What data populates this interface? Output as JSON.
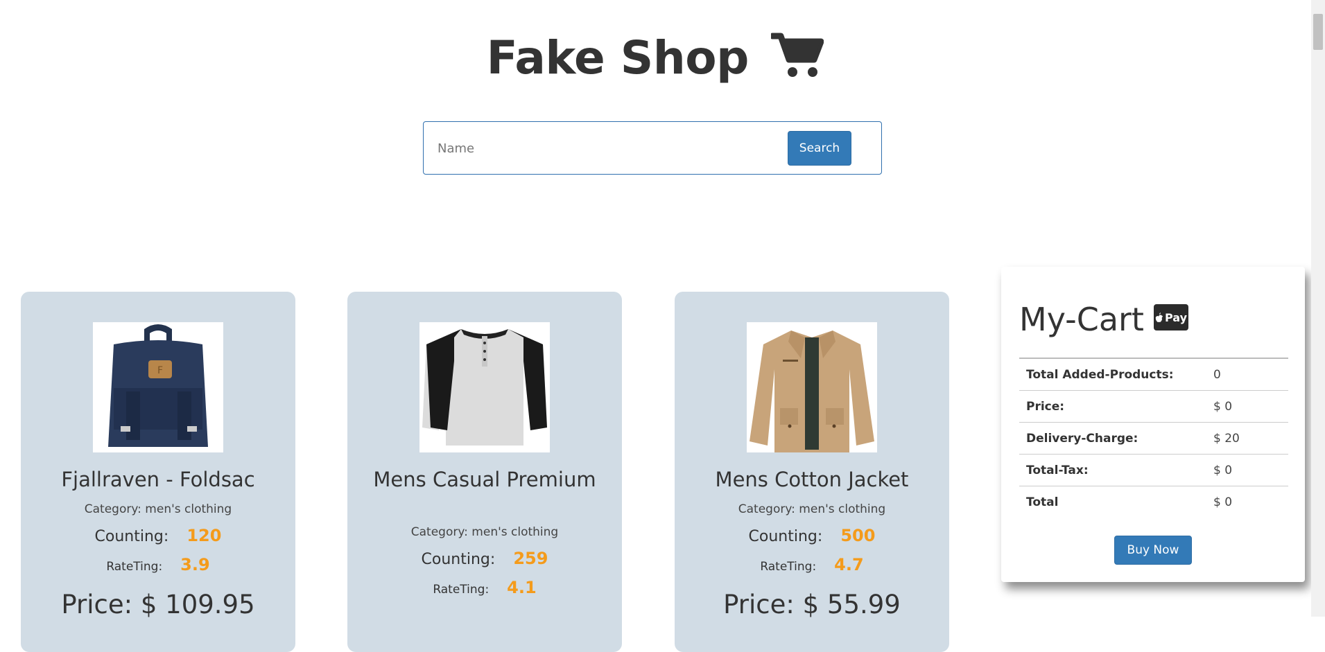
{
  "header": {
    "title": "Fake Shop",
    "icon": "cart-icon"
  },
  "search": {
    "placeholder": "Name",
    "value": "",
    "button_label": "Search"
  },
  "products": [
    {
      "name": "Fjallraven - Foldsac",
      "category": "Category: men's clothing",
      "counting_label": "Counting:",
      "counting_value": "120",
      "rating_label": "RateTing:",
      "rating_value": "3.9",
      "price": "Price: $ 109.95",
      "image": "backpack-image"
    },
    {
      "name": "Mens Casual Premium",
      "category": "Category: men's clothing",
      "counting_label": "Counting:",
      "counting_value": "259",
      "rating_label": "RateTing:",
      "rating_value": "4.1",
      "price": "",
      "image": "raglan-tshirt-image"
    },
    {
      "name": "Mens Cotton Jacket",
      "category": "Category: men's clothing",
      "counting_label": "Counting:",
      "counting_value": "500",
      "rating_label": "RateTing:",
      "rating_value": "4.7",
      "price": "Price: $ 55.99",
      "image": "cotton-jacket-image"
    }
  ],
  "cart": {
    "title": "My-Cart",
    "pay_badge": "Pay",
    "rows": [
      {
        "label": "Total Added-Products:",
        "value": "0"
      },
      {
        "label": "Price:",
        "value": "$ 0"
      },
      {
        "label": "Delivery-Charge:",
        "value": "$ 20"
      },
      {
        "label": "Total-Tax:",
        "value": "$ 0"
      },
      {
        "label": "Total",
        "value": "$ 0"
      }
    ],
    "buy_label": "Buy Now"
  },
  "colors": {
    "accent": "#337ab7",
    "card_bg": "#d1dce5",
    "highlight": "#f49b1b"
  }
}
